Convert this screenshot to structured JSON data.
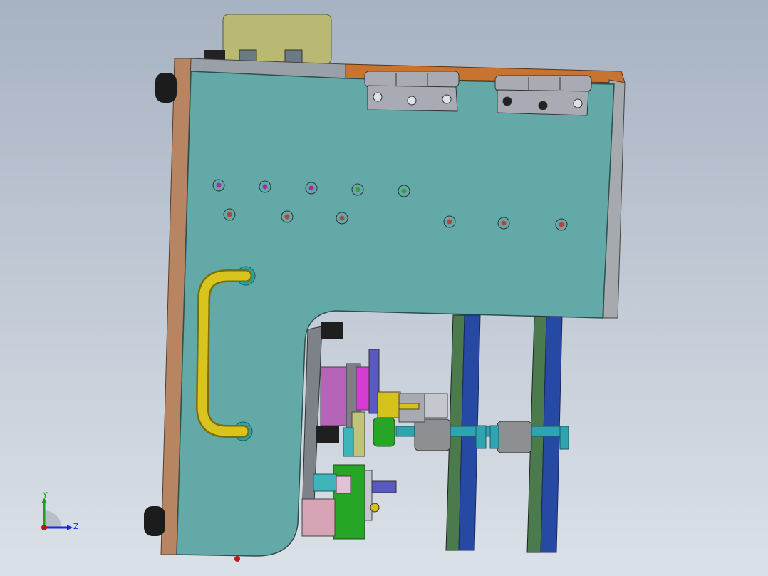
{
  "viewport": {
    "background_top": "#a7b2c2",
    "background_bottom": "#dbe1e8"
  },
  "triad": {
    "y_label": "Y",
    "z_label": "Z",
    "y_color": "#1aa31a",
    "z_color": "#1a2ad6",
    "x_color": "#cc1111"
  },
  "model": {
    "plate_color": "#62a9a8",
    "top_edge_color": "#c8732f",
    "side_edge_color": "#b78562",
    "handle_color": "#d8c41c",
    "top_block_color": "#b9b973",
    "rail_green": "#4b7a4c",
    "rail_blue": "#2649a4",
    "hinge_color": "#a9abb4"
  }
}
